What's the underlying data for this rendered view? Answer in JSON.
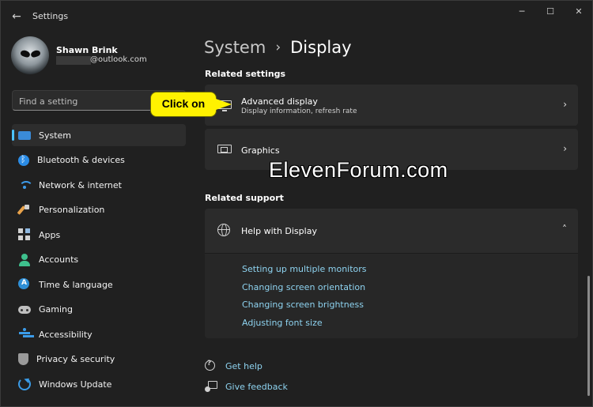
{
  "window": {
    "title": "Settings",
    "back_icon": "arrow-left-icon",
    "controls": {
      "minimize": "─",
      "maximize": "☐",
      "close": "✕"
    }
  },
  "user": {
    "name": "Shawn Brink",
    "email_suffix": "@outlook.com"
  },
  "search": {
    "placeholder": "Find a setting"
  },
  "nav": {
    "items": [
      {
        "label": "System",
        "icon": "system-icon",
        "selected": true
      },
      {
        "label": "Bluetooth & devices",
        "icon": "bluetooth-icon"
      },
      {
        "label": "Network & internet",
        "icon": "wifi-icon"
      },
      {
        "label": "Personalization",
        "icon": "brush-icon"
      },
      {
        "label": "Apps",
        "icon": "apps-icon"
      },
      {
        "label": "Accounts",
        "icon": "account-icon"
      },
      {
        "label": "Time & language",
        "icon": "time-language-icon"
      },
      {
        "label": "Gaming",
        "icon": "controller-icon"
      },
      {
        "label": "Accessibility",
        "icon": "accessibility-icon"
      },
      {
        "label": "Privacy & security",
        "icon": "shield-icon"
      },
      {
        "label": "Windows Update",
        "icon": "update-icon"
      }
    ],
    "accent_color": "#4cc2ff"
  },
  "breadcrumb": {
    "parent": "System",
    "separator": "›",
    "current": "Display"
  },
  "related_settings": {
    "title": "Related settings",
    "cards": [
      {
        "title": "Advanced display",
        "subtitle": "Display information, refresh rate",
        "icon": "monitor-icon",
        "chevron": "›"
      },
      {
        "title": "Graphics",
        "icon": "graphics-card-icon",
        "chevron": "›"
      }
    ]
  },
  "related_support": {
    "title": "Related support",
    "help": {
      "title": "Help with Display",
      "icon": "globe-icon",
      "chevron": "˄",
      "links": [
        "Setting up multiple monitors",
        "Changing screen orientation",
        "Changing screen brightness",
        "Adjusting font size"
      ]
    }
  },
  "footer_links": {
    "get_help": "Get help",
    "give_feedback": "Give feedback"
  },
  "overlay": {
    "callout": "Click on",
    "watermark": "ElevenForum.com",
    "callout_color": "#fff200"
  },
  "link_color": "#8ed3f0"
}
